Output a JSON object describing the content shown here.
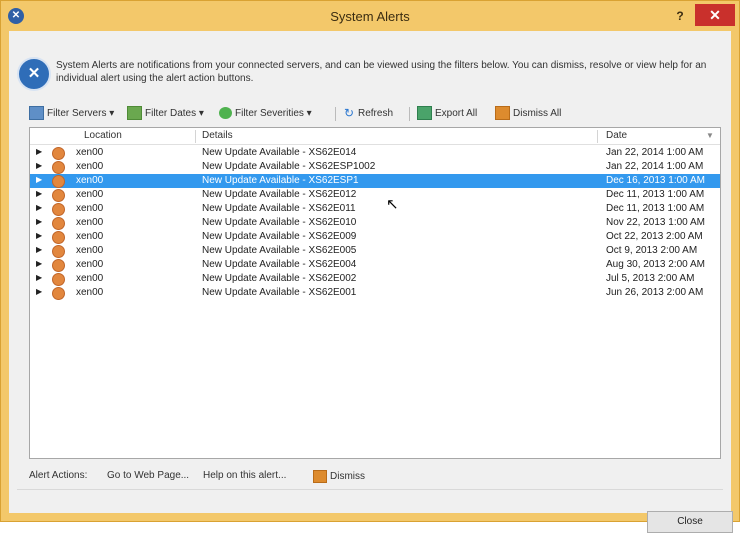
{
  "window": {
    "title": "System Alerts",
    "help_label": "?",
    "close_label": "✕"
  },
  "description": "System Alerts are notifications from your connected servers, and can be viewed using the filters below. You can dismiss, resolve or view help for an individual alert using the alert action buttons.",
  "toolbar": {
    "filter_servers": "Filter Servers ▾",
    "filter_dates": "Filter Dates ▾",
    "filter_severities": "Filter Severities ▾",
    "refresh": "Refresh",
    "export_all": "Export All",
    "dismiss_all": "Dismiss All"
  },
  "table": {
    "headers": {
      "location": "Location",
      "details": "Details",
      "date": "Date"
    },
    "rows": [
      {
        "location": "xen00",
        "details": "New Update Available - XS62E014",
        "date": "Jan 22, 2014 1:00 AM",
        "selected": false
      },
      {
        "location": "xen00",
        "details": "New Update Available - XS62ESP1002",
        "date": "Jan 22, 2014 1:00 AM",
        "selected": false
      },
      {
        "location": "xen00",
        "details": "New Update Available - XS62ESP1",
        "date": "Dec 16, 2013 1:00 AM",
        "selected": true
      },
      {
        "location": "xen00",
        "details": "New Update Available - XS62E012",
        "date": "Dec 11, 2013 1:00 AM",
        "selected": false
      },
      {
        "location": "xen00",
        "details": "New Update Available - XS62E011",
        "date": "Dec 11, 2013 1:00 AM",
        "selected": false
      },
      {
        "location": "xen00",
        "details": "New Update Available - XS62E010",
        "date": "Nov 22, 2013 1:00 AM",
        "selected": false
      },
      {
        "location": "xen00",
        "details": "New Update Available - XS62E009",
        "date": "Oct 22, 2013 2:00 AM",
        "selected": false
      },
      {
        "location": "xen00",
        "details": "New Update Available - XS62E005",
        "date": "Oct 9, 2013 2:00 AM",
        "selected": false
      },
      {
        "location": "xen00",
        "details": "New Update Available - XS62E004",
        "date": "Aug 30, 2013 2:00 AM",
        "selected": false
      },
      {
        "location": "xen00",
        "details": "New Update Available - XS62E002",
        "date": "Jul 5, 2013 2:00 AM",
        "selected": false
      },
      {
        "location": "xen00",
        "details": "New Update Available - XS62E001",
        "date": "Jun 26, 2013 2:00 AM",
        "selected": false
      }
    ]
  },
  "alert_actions": {
    "label": "Alert Actions:",
    "go_to_web_page": "Go to Web Page...",
    "help_on_alert": "Help on this alert...",
    "dismiss": "Dismiss"
  },
  "close_button": "Close",
  "colors": {
    "titlebar": "#f3c86a",
    "selection": "#3399ee",
    "close": "#c9302c"
  },
  "icons": [
    "app-icon",
    "info-icon",
    "server-icon",
    "calendar-icon",
    "severity-icon",
    "refresh-icon",
    "export-icon",
    "dismiss-icon",
    "alert-severity-icon",
    "expand-arrow-icon"
  ]
}
